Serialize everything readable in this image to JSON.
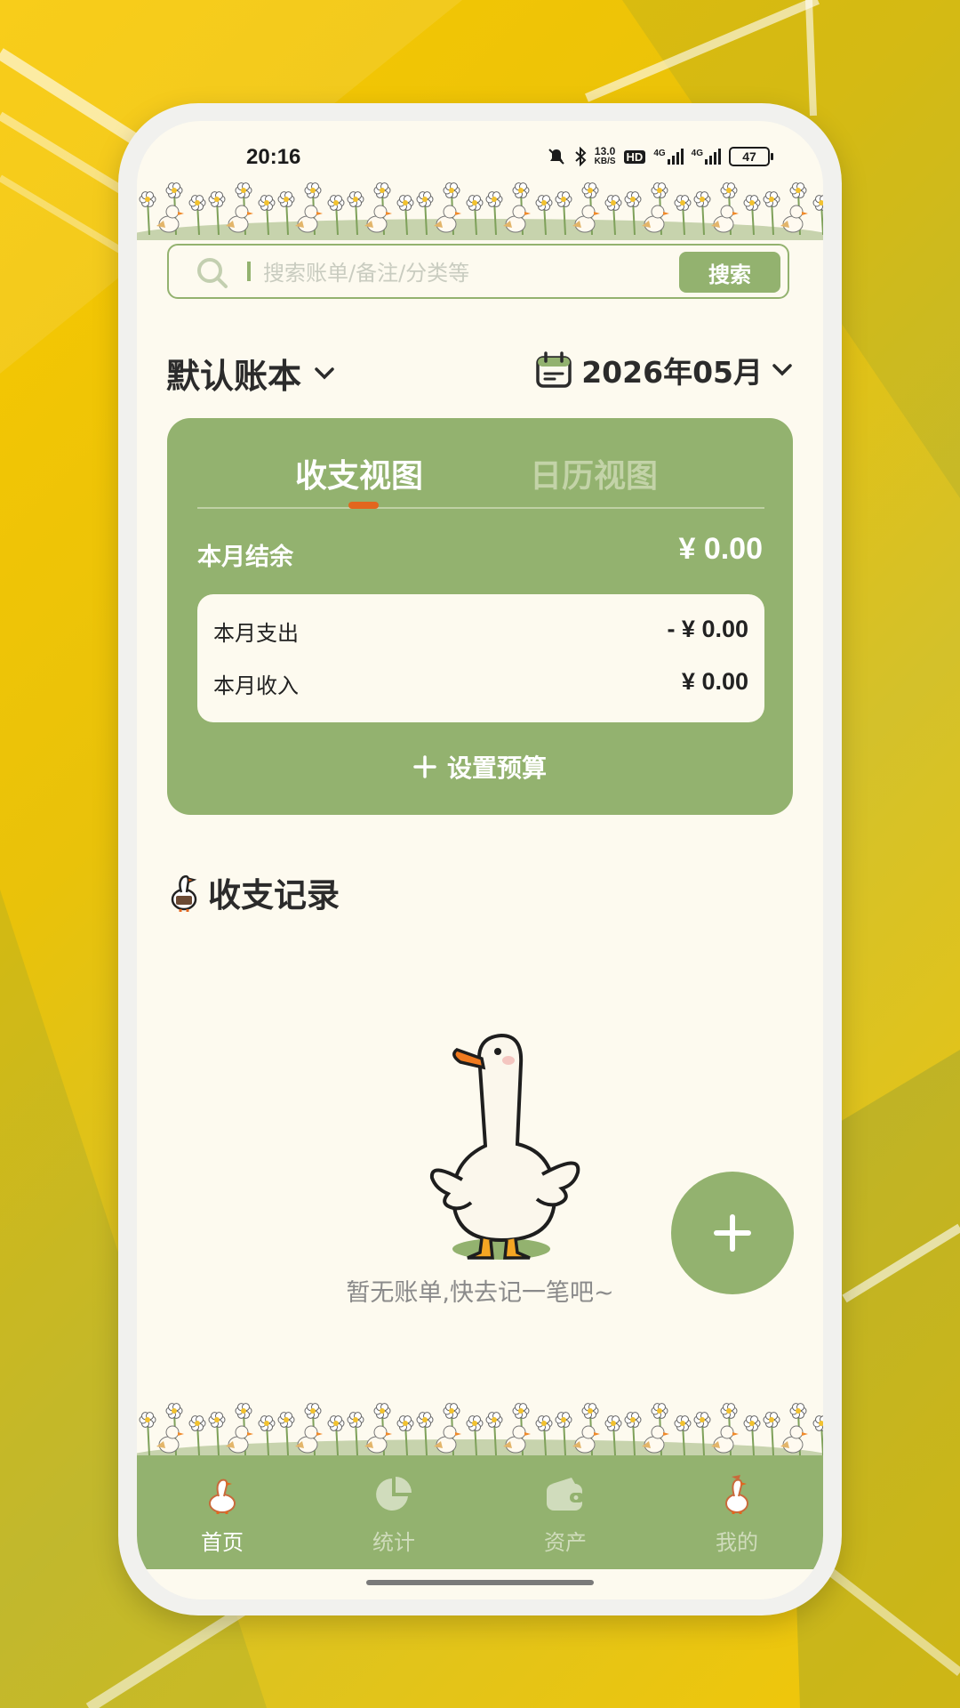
{
  "status_bar": {
    "time": "20:16",
    "speed_top": "13.0",
    "speed_bottom": "KB/S",
    "hd": "HD",
    "net1": "4G",
    "net2": "4G",
    "battery": "47"
  },
  "search": {
    "placeholder": "搜索账单/备注/分类等",
    "button_label": "搜索"
  },
  "header": {
    "book_name": "默认账本",
    "month": "2026年05月"
  },
  "card": {
    "tabs": [
      {
        "label": "收支视图",
        "active": true
      },
      {
        "label": "日历视图",
        "active": false
      }
    ],
    "balance_label": "本月结余",
    "balance_value": "¥ 0.00",
    "expense_label": "本月支出",
    "expense_value": "- ¥ 0.00",
    "income_label": "本月收入",
    "income_value": "¥ 0.00",
    "budget_label": "设置预算"
  },
  "records": {
    "title": "收支记录",
    "empty_text": "暂无账单,快去记一笔吧~"
  },
  "nav": {
    "items": [
      {
        "label": "首页",
        "icon": "goose-home-icon",
        "active": true
      },
      {
        "label": "统计",
        "icon": "pie-chart-icon",
        "active": false
      },
      {
        "label": "资产",
        "icon": "wallet-icon",
        "active": false
      },
      {
        "label": "我的",
        "icon": "goose-profile-icon",
        "active": false
      }
    ]
  },
  "colors": {
    "primary_green": "#93b26f",
    "background_cream": "#fdfaef",
    "accent_orange": "#e2661e",
    "page_yellow": "#f8c800"
  }
}
